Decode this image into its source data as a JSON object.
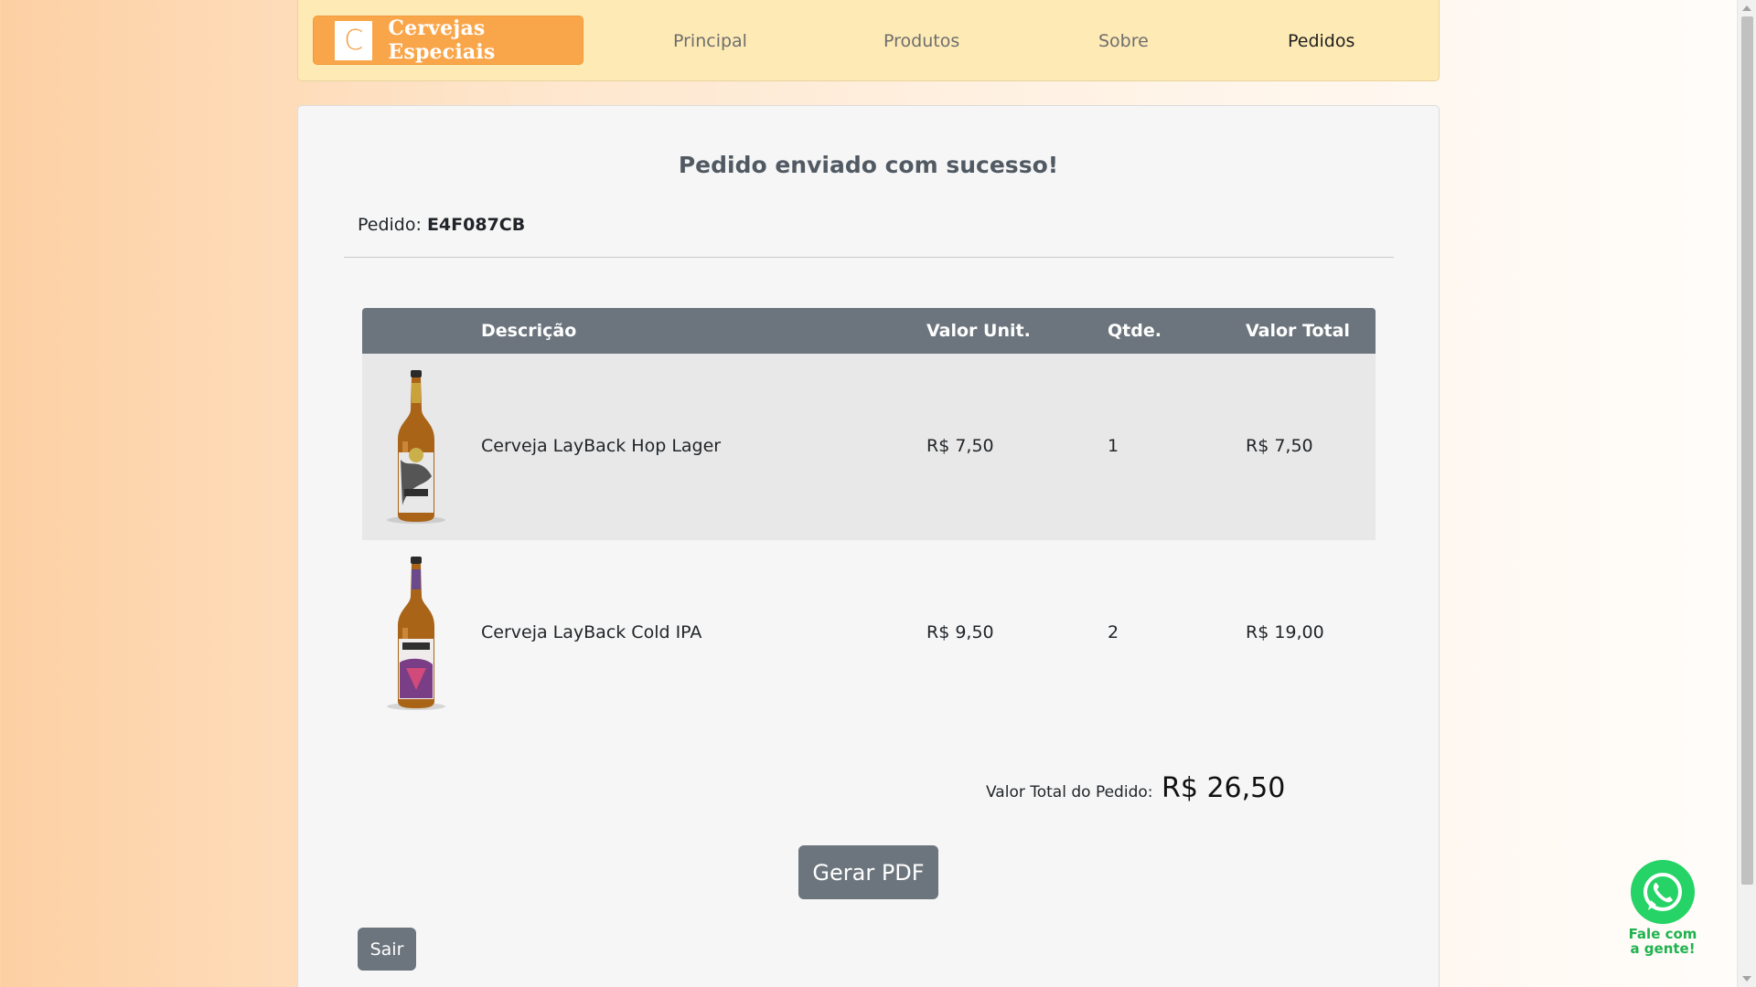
{
  "navbar": {
    "brand_logo_letter": "C",
    "brand_name": "Cervejas Especiais",
    "links": [
      "Principal",
      "Produtos",
      "Sobre",
      "Pedidos"
    ],
    "active_link": "Pedidos"
  },
  "order": {
    "success_message": "Pedido enviado com sucesso!",
    "order_label": "Pedido:",
    "order_code": "E4F087CB",
    "table_headers": {
      "description": "Descrição",
      "unit_price": "Valor Unit.",
      "quantity": "Qtde.",
      "total": "Valor Total"
    },
    "items": [
      {
        "description": "Cerveja LayBack Hop Lager",
        "unit_price": "R$ 7,50",
        "quantity": "1",
        "total": "R$ 7,50",
        "image_icon": "beer-bottle-hop-lager"
      },
      {
        "description": "Cerveja LayBack Cold IPA",
        "unit_price": "R$ 9,50",
        "quantity": "2",
        "total": "R$ 19,00",
        "image_icon": "beer-bottle-cold-ipa"
      }
    ],
    "total_label": "Valor Total do Pedido:",
    "total_value": "R$ 26,50",
    "pdf_button": "Gerar PDF",
    "exit_button": "Sair"
  },
  "whatsapp": {
    "label_line1": "Fale com",
    "label_line2": "a gente!",
    "color": "#25d366"
  },
  "colors": {
    "accent_orange": "#f9a64a",
    "navbar_bg": "#feeab5",
    "table_header_bg": "#6c757d",
    "button_bg": "#6c757d"
  }
}
